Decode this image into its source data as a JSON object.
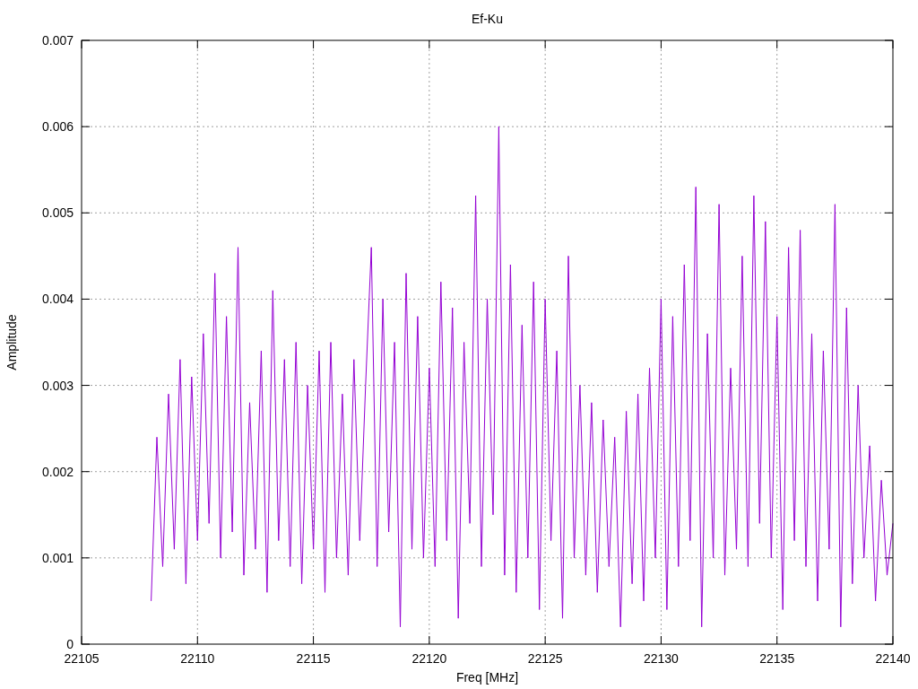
{
  "chart_data": {
    "type": "line",
    "title": "Ef-Ku",
    "xlabel": "Freq [MHz]",
    "ylabel": "Amplitude",
    "grid": true,
    "xlim": [
      22105,
      22140
    ],
    "ylim": [
      0,
      0.007
    ],
    "xticks": [
      {
        "value": 22105,
        "label": "22105"
      },
      {
        "value": 22110,
        "label": "22110"
      },
      {
        "value": 22115,
        "label": "22115"
      },
      {
        "value": 22120,
        "label": "22120"
      },
      {
        "value": 22125,
        "label": "22125"
      },
      {
        "value": 22130,
        "label": "22130"
      },
      {
        "value": 22135,
        "label": "22135"
      },
      {
        "value": 22140,
        "label": "22140"
      }
    ],
    "yticks": [
      {
        "value": 0,
        "label": "0"
      },
      {
        "value": 0.001,
        "label": "0.001"
      },
      {
        "value": 0.002,
        "label": "0.002"
      },
      {
        "value": 0.003,
        "label": "0.003"
      },
      {
        "value": 0.004,
        "label": "0.004"
      },
      {
        "value": 0.005,
        "label": "0.005"
      },
      {
        "value": 0.006,
        "label": "0.006"
      },
      {
        "value": 0.007,
        "label": "0.007"
      }
    ],
    "x": [
      22108,
      22108.25,
      22108.5,
      22108.75,
      22109,
      22109.25,
      22109.5,
      22109.75,
      22110,
      22110.25,
      22110.5,
      22110.75,
      22111,
      22111.25,
      22111.5,
      22111.75,
      22112,
      22112.25,
      22112.5,
      22112.75,
      22113,
      22113.25,
      22113.5,
      22113.75,
      22114,
      22114.25,
      22114.5,
      22114.75,
      22115,
      22115.25,
      22115.5,
      22115.75,
      22116,
      22116.25,
      22116.5,
      22116.75,
      22117,
      22117.25,
      22117.5,
      22117.75,
      22118,
      22118.25,
      22118.5,
      22118.75,
      22119,
      22119.25,
      22119.5,
      22119.75,
      22120,
      22120.25,
      22120.5,
      22120.75,
      22121,
      22121.25,
      22121.5,
      22121.75,
      22122,
      22122.25,
      22122.5,
      22122.75,
      22123,
      22123.25,
      22123.5,
      22123.75,
      22124,
      22124.25,
      22124.5,
      22124.75,
      22125,
      22125.25,
      22125.5,
      22125.75,
      22126,
      22126.25,
      22126.5,
      22126.75,
      22127,
      22127.25,
      22127.5,
      22127.75,
      22128,
      22128.25,
      22128.5,
      22128.75,
      22129,
      22129.25,
      22129.5,
      22129.75,
      22130,
      22130.25,
      22130.5,
      22130.75,
      22131,
      22131.25,
      22131.5,
      22131.75,
      22132,
      22132.25,
      22132.5,
      22132.75,
      22133,
      22133.25,
      22133.5,
      22133.75,
      22134,
      22134.25,
      22134.5,
      22134.75,
      22135,
      22135.25,
      22135.5,
      22135.75,
      22136,
      22136.25,
      22136.5,
      22136.75,
      22137,
      22137.25,
      22137.5,
      22137.75,
      22138,
      22138.25,
      22138.5,
      22138.75,
      22139,
      22139.25,
      22139.5,
      22139.75,
      22140
    ],
    "series": [
      {
        "color": "#9400d3",
        "values": [
          0.0005,
          0.0024,
          0.0009,
          0.0029,
          0.0011,
          0.0033,
          0.0007,
          0.0031,
          0.0012,
          0.0036,
          0.0014,
          0.0043,
          0.001,
          0.0038,
          0.0013,
          0.0046,
          0.0008,
          0.0028,
          0.0011,
          0.0034,
          0.0006,
          0.0041,
          0.0012,
          0.0033,
          0.0009,
          0.0035,
          0.0007,
          0.003,
          0.0011,
          0.0034,
          0.0006,
          0.0035,
          0.001,
          0.0029,
          0.0008,
          0.0033,
          0.0012,
          0.003,
          0.0046,
          0.0009,
          0.004,
          0.0013,
          0.0035,
          0.0002,
          0.0043,
          0.0011,
          0.0038,
          0.001,
          0.0032,
          0.0009,
          0.0042,
          0.0012,
          0.0039,
          0.0003,
          0.0035,
          0.0014,
          0.0052,
          0.0009,
          0.004,
          0.0015,
          0.006,
          0.0008,
          0.0044,
          0.0006,
          0.0037,
          0.001,
          0.0042,
          0.0004,
          0.004,
          0.0012,
          0.0034,
          0.0003,
          0.0045,
          0.001,
          0.003,
          0.0008,
          0.0028,
          0.0006,
          0.0026,
          0.0009,
          0.0024,
          0.0002,
          0.0027,
          0.0007,
          0.0029,
          0.0005,
          0.0032,
          0.001,
          0.004,
          0.0004,
          0.0038,
          0.0009,
          0.0044,
          0.0012,
          0.0053,
          0.0002,
          0.0036,
          0.001,
          0.0051,
          0.0008,
          0.0032,
          0.0011,
          0.0045,
          0.0009,
          0.0052,
          0.0014,
          0.0049,
          0.001,
          0.0038,
          0.0004,
          0.0046,
          0.0012,
          0.0048,
          0.0009,
          0.0036,
          0.0005,
          0.0034,
          0.0011,
          0.0051,
          0.0002,
          0.0039,
          0.0007,
          0.003,
          0.001,
          0.0023,
          0.0005,
          0.0019,
          0.0008,
          0.0014
        ]
      }
    ]
  }
}
